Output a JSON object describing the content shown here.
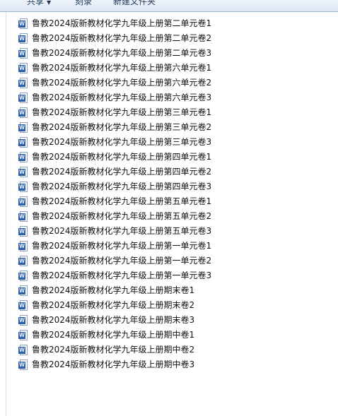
{
  "toolbar": {
    "share_label": "共享",
    "share_arrow": "▼",
    "burn_label": "刻录",
    "new_folder_label": "新建文件夹"
  },
  "icon": {
    "name": "word-document-icon",
    "glyph": "W",
    "color": "#2b5faa"
  },
  "files": [
    "鲁教2024版新教材化学九年级上册第二单元卷1",
    "鲁教2024版新教材化学九年级上册第二单元卷2",
    "鲁教2024版新教材化学九年级上册第二单元卷3",
    "鲁教2024版新教材化学九年级上册第六单元卷1",
    "鲁教2024版新教材化学九年级上册第六单元卷2",
    "鲁教2024版新教材化学九年级上册第六单元卷3",
    "鲁教2024版新教材化学九年级上册第三单元卷1",
    "鲁教2024版新教材化学九年级上册第三单元卷2",
    "鲁教2024版新教材化学九年级上册第三单元卷3",
    "鲁教2024版新教材化学九年级上册第四单元卷1",
    "鲁教2024版新教材化学九年级上册第四单元卷2",
    "鲁教2024版新教材化学九年级上册第四单元卷3",
    "鲁教2024版新教材化学九年级上册第五单元卷1",
    "鲁教2024版新教材化学九年级上册第五单元卷2",
    "鲁教2024版新教材化学九年级上册第五单元卷3",
    "鲁教2024版新教材化学九年级上册第一单元卷1",
    "鲁教2024版新教材化学九年级上册第一单元卷2",
    "鲁教2024版新教材化学九年级上册第一单元卷3",
    "鲁教2024版新教材化学九年级上册期末卷1",
    "鲁教2024版新教材化学九年级上册期末卷2",
    "鲁教2024版新教材化学九年级上册期末卷3",
    "鲁教2024版新教材化学九年级上册期中卷1",
    "鲁教2024版新教材化学九年级上册期中卷2",
    "鲁教2024版新教材化学九年级上册期中卷3"
  ]
}
